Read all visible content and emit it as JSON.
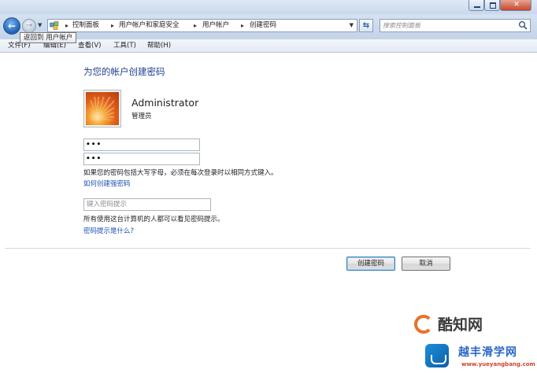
{
  "window": {
    "controls": {
      "minimize_icon": "minimize-icon",
      "maximize_icon": "maximize-icon",
      "close_icon": "close-icon"
    }
  },
  "nav": {
    "back_tooltip": "返回到 用户帐户",
    "address_icon": "control-panel-icon",
    "breadcrumbs": [
      "控制面板",
      "用户帐户和家庭安全",
      "用户帐户",
      "创建密码"
    ],
    "search_placeholder": "搜索控制面板"
  },
  "menu": {
    "items": [
      "文件(F)",
      "编辑(E)",
      "查看(V)",
      "工具(T)",
      "帮助(H)"
    ]
  },
  "main": {
    "heading": "为您的帐户创建密码",
    "user": {
      "name": "Administrator",
      "role": "管理员"
    },
    "new_password_value": "•••",
    "confirm_password_value": "•••",
    "case_note": "如果您的密码包括大写字母，必须在每次登录时以相同方式键入。",
    "strong_password_link": "如何创建强密码",
    "hint_placeholder": "键入密码提示",
    "hint_note": "所有使用这台计算机的人都可以看见密码提示。",
    "hint_link": "密码提示是什么?",
    "create_button": "创建密码",
    "cancel_button": "取消"
  },
  "watermark": {
    "logo_text": "酷知网",
    "badge_title": "越丰滑学网",
    "badge_url": "www.yueyangbang.com"
  },
  "colors": {
    "link": "#1a4fb5",
    "heading": "#1e3f8f",
    "chrome": "#c3d3e8"
  }
}
